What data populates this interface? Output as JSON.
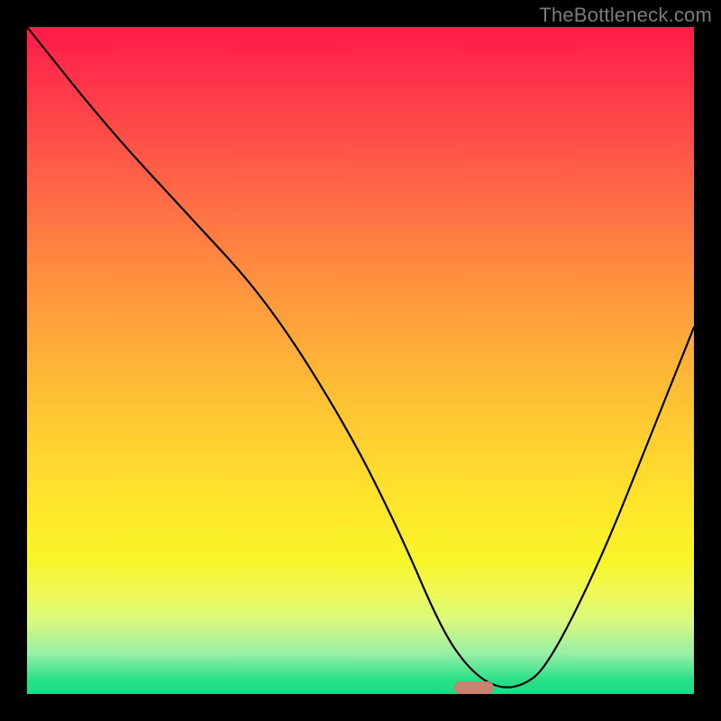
{
  "attribution": "TheBottleneck.com",
  "chart_data": {
    "type": "line",
    "title": "",
    "xlabel": "",
    "ylabel": "",
    "xlim": [
      0,
      100
    ],
    "ylim": [
      0,
      100
    ],
    "series": [
      {
        "name": "bottleneck-curve",
        "x": [
          0,
          12,
          24,
          36,
          48,
          56,
          62,
          66,
          70,
          74,
          78,
          86,
          94,
          100
        ],
        "values": [
          100,
          85,
          72,
          59,
          40,
          24,
          10,
          4,
          1,
          1,
          4,
          20,
          40,
          55
        ]
      }
    ],
    "marker": {
      "x_center": 67,
      "y": 1,
      "width_pct": 6
    },
    "colors": {
      "gradient_top": "#ff1a4b",
      "gradient_mid": "#ffd030",
      "gradient_bottom": "#1bdc86",
      "curve": "#000000",
      "marker": "#d8786e",
      "frame": "#000000"
    }
  }
}
